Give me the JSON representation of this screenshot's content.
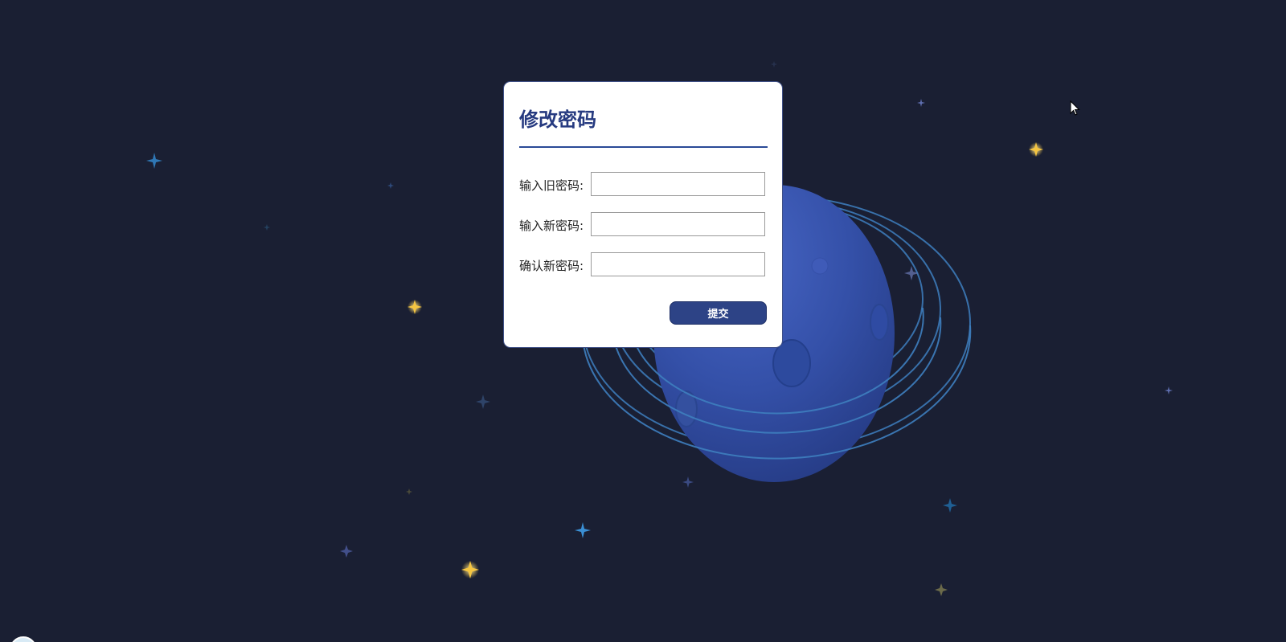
{
  "form": {
    "title": "修改密码",
    "fields": [
      {
        "label": "输入旧密码:",
        "value": "",
        "placeholder": ""
      },
      {
        "label": "输入新密码:",
        "value": "",
        "placeholder": ""
      },
      {
        "label": "确认新密码:",
        "value": "",
        "placeholder": ""
      }
    ],
    "submit_label": "提交"
  },
  "background": {
    "base_color": "#1a1f33",
    "planet_color": "#3a56ad",
    "ring_color": "#3e7fbf",
    "star_colors": [
      "#f5c542",
      "#3a8fd4",
      "#5f6fb0"
    ]
  },
  "colors": {
    "accent": "#263a80",
    "button": "#2d4386",
    "card": "#ffffff"
  }
}
